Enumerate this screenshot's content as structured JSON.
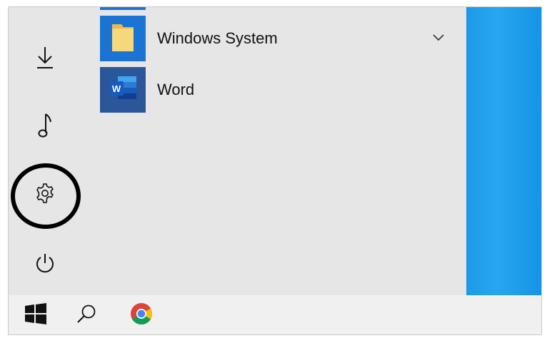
{
  "start_menu": {
    "rail": {
      "downloads_icon": "download-arrow-icon",
      "music_icon": "music-note-icon",
      "settings_icon": "gear-icon",
      "power_icon": "power-icon"
    },
    "apps": [
      {
        "label": "Windows System",
        "icon": "folder-icon",
        "tile_color": "#1b74d4",
        "expandable": true
      },
      {
        "label": "Word",
        "icon": "word-icon",
        "tile_color": "#2b579a",
        "expandable": false
      }
    ]
  },
  "taskbar": {
    "start_icon": "windows-logo-icon",
    "search_icon": "search-icon",
    "chrome_icon": "chrome-icon"
  },
  "colors": {
    "menu_bg": "#e6e6e6",
    "desktop_accent": "#1c9ae8",
    "taskbar_bg": "#f0f0f0",
    "highlight_ring": "#000000"
  }
}
